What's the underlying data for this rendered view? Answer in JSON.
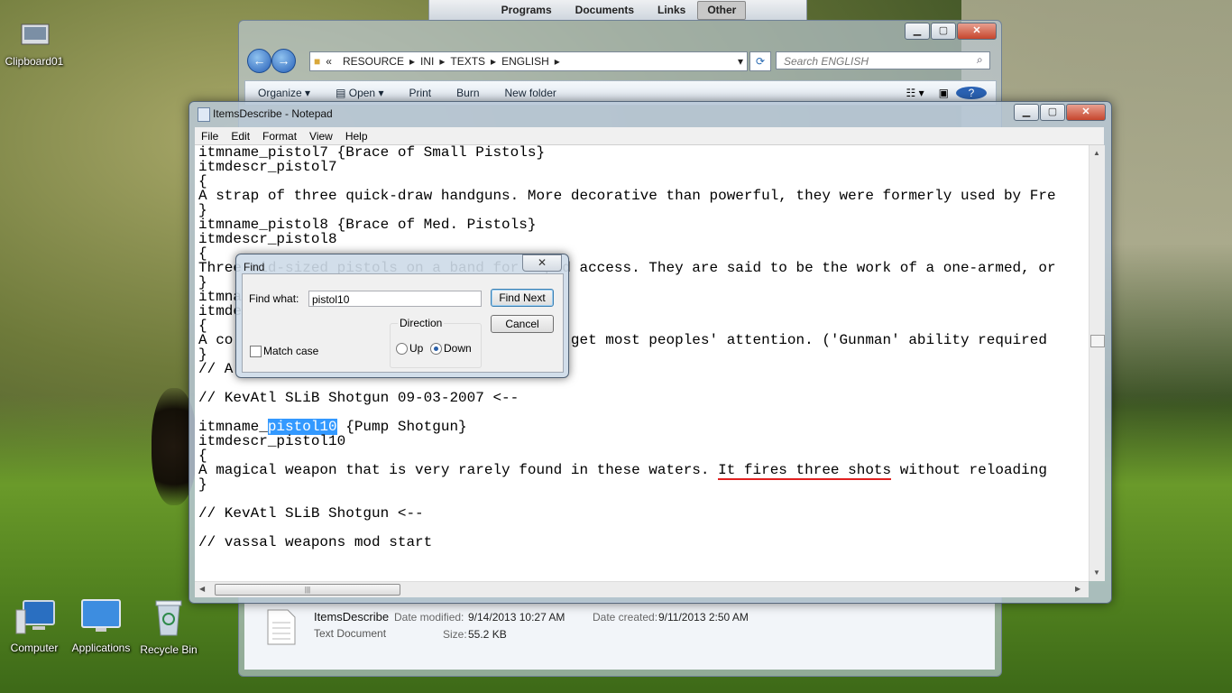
{
  "taskbar": {
    "tabs": [
      "Programs",
      "Documents",
      "Links",
      "Other"
    ],
    "active": "Other"
  },
  "desktop": {
    "clipboard_label": "Clipboard01",
    "computer_label": "Computer",
    "applications_label": "Applications",
    "recycle_label": "Recycle Bin"
  },
  "explorer": {
    "breadcrumb": [
      "«",
      "RESOURCE",
      "INI",
      "TEXTS",
      "ENGLISH"
    ],
    "search_placeholder": "Search ENGLISH",
    "toolbar": [
      "Organize",
      "Open",
      "Print",
      "Burn",
      "New folder"
    ],
    "details": {
      "filename": "ItemsDescribe",
      "filetype": "Text Document",
      "date_modified_label": "Date modified:",
      "date_modified": "9/14/2013 10:27 AM",
      "size_label": "Size:",
      "size": "55.2 KB",
      "date_created_label": "Date created:",
      "date_created": "9/11/2013 2:50 AM"
    }
  },
  "notepad": {
    "title": "ItemsDescribe - Notepad",
    "menu": [
      "File",
      "Edit",
      "Format",
      "View",
      "Help"
    ],
    "lines": [
      "itmname_pistol7 {Brace of Small Pistols}",
      "itmdescr_pistol7",
      "{",
      "A strap of three quick-draw handguns. More decorative than powerful, they were formerly used by Fre",
      "}",
      "itmname_pistol8 {Brace of Med. Pistols}",
      "itmdescr_pistol8",
      "{",
      "Three mid-sized pistols on a band for rapid access. They are said to be the work of a one-armed, or",
      "}",
      "itmna",
      "itmde",
      "{",
      "A co                                    ld get most peoples' attention. ('Gunman' ability required",
      "}",
      "// A",
      "",
      "// KevAtl SLiB Shotgun 09-03-2007 <--",
      "",
      "",
      "itmdescr_pistol10",
      "{",
      "",
      "}",
      "",
      "// KevAtl SLiB Shotgun <--",
      "",
      "// vassal weapons mod start"
    ],
    "highlight_line": {
      "pre": "itmname_",
      "sel": "pistol10",
      "post": " {Pump Shotgun}"
    },
    "squiggle_line": {
      "pre": "A magical weapon that is very rarely found in these waters. ",
      "err": "It fires three shots",
      "post": " without reloading"
    }
  },
  "find_dialog": {
    "title": "Find",
    "find_what_label": "Find what:",
    "find_what_value": "pistol10",
    "find_next": "Find Next",
    "cancel": "Cancel",
    "direction_label": "Direction",
    "up_label": "Up",
    "down_label": "Down",
    "match_case_label": "Match case"
  }
}
